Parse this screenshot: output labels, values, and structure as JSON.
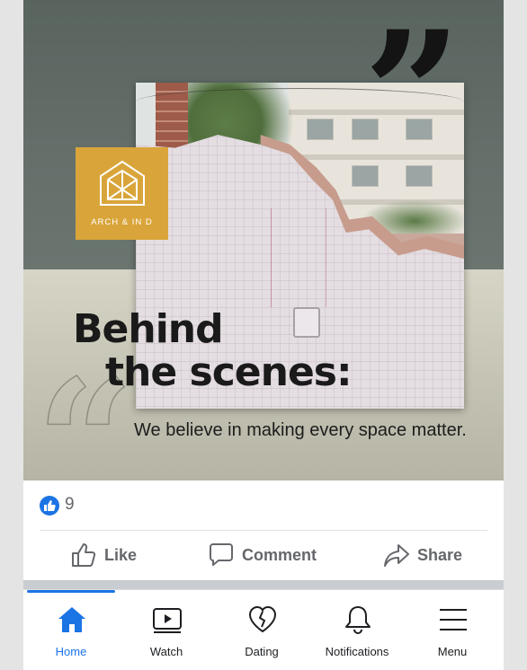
{
  "post": {
    "logo_text": "ARCH & IN D",
    "headline_line1": "Behind",
    "headline_line2": "the scenes:",
    "tagline": "We believe in making every space matter."
  },
  "reactions": {
    "count": "9",
    "icon": "like-icon"
  },
  "actions": {
    "like": "Like",
    "comment": "Comment",
    "share": "Share"
  },
  "bottom_nav": {
    "items": [
      {
        "label": "Home",
        "icon": "home-icon",
        "active": true
      },
      {
        "label": "Watch",
        "icon": "watch-icon"
      },
      {
        "label": "Dating",
        "icon": "dating-icon"
      },
      {
        "label": "Notifications",
        "icon": "bell-icon"
      },
      {
        "label": "Menu",
        "icon": "menu-icon"
      }
    ]
  },
  "colors": {
    "accent": "#1b74e4",
    "logo_bg": "#d9a53a",
    "icon_gray": "#65676b"
  }
}
